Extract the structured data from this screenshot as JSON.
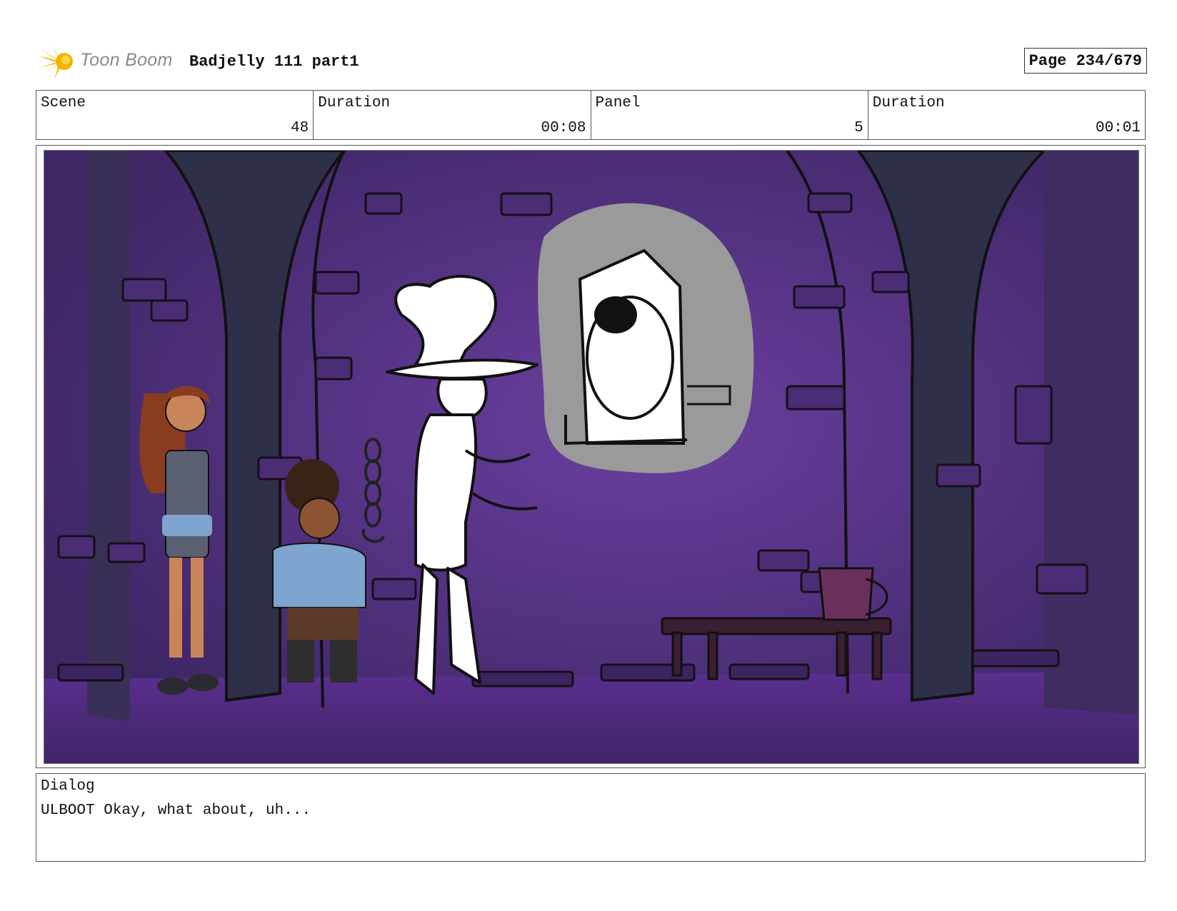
{
  "header": {
    "logo_text": "Toon Boom",
    "project_title": "Badjelly 111 part1",
    "page_label": "Page 234/679"
  },
  "info": {
    "scene_label": "Scene",
    "scene_value": "48",
    "scene_duration_label": "Duration",
    "scene_duration_value": "00:08",
    "panel_label": "Panel",
    "panel_value": "5",
    "panel_duration_label": "Duration",
    "panel_duration_value": "00:01"
  },
  "dialog": {
    "label": "Dialog",
    "text": "ULBOOT Okay, what about, uh..."
  },
  "colors": {
    "logo_accent": "#f5b400",
    "wall_purple": "#4e2f78",
    "pillar_dark": "#2e2f48",
    "thought_bubble_gray": "#9a9a9a"
  },
  "icons": {
    "logo": "toon-boom-star-logo"
  }
}
